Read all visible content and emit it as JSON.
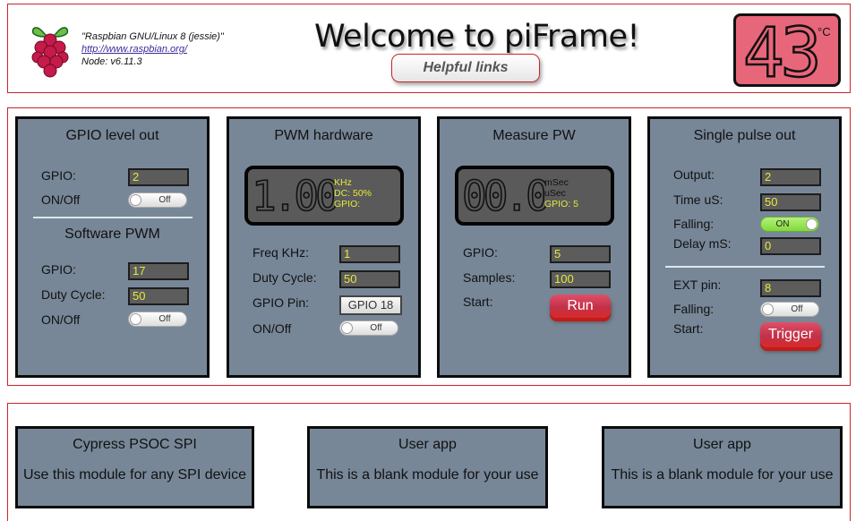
{
  "header": {
    "sysinfo": {
      "os": "\"Raspbian GNU/Linux 8 (jessie)\"",
      "url": "http://www.raspbian.org/",
      "node": "Node: v6.11.3"
    },
    "title": "Welcome to piFrame!",
    "helpful_links_label": "Helpful links",
    "temperature": {
      "value": "43",
      "unit": "°C",
      "color": "#e8667a"
    }
  },
  "modules": {
    "gpio_level_out": {
      "title": "GPIO level out",
      "gpio_label": "GPIO:",
      "gpio_value": "2",
      "onoff_label": "ON/Off",
      "toggle_label": "Off",
      "software_pwm": {
        "title": "Software PWM",
        "gpio_label": "GPIO:",
        "gpio_value": "17",
        "duty_label": "Duty Cycle:",
        "duty_value": "50",
        "onoff_label": "ON/Off",
        "toggle_label": "Off"
      }
    },
    "pwm_hardware": {
      "title": "PWM hardware",
      "display": {
        "value": "1.00",
        "unit": "KHz",
        "dc": "DC: 50%",
        "gpio": "GPIO:"
      },
      "freq_label": "Freq KHz:",
      "freq_value": "1",
      "duty_label": "Duty Cycle:",
      "duty_value": "50",
      "gpio_pin_label": "GPIO Pin:",
      "gpio_pin_button": "GPIO 18",
      "onoff_label": "ON/Off",
      "toggle_label": "Off"
    },
    "measure_pw": {
      "title": "Measure PW",
      "display": {
        "value": "00.0",
        "unit1": "mSec",
        "unit2": "uSec",
        "gpio": "GPIO: 5"
      },
      "gpio_label": "GPIO:",
      "gpio_value": "5",
      "samples_label": "Samples:",
      "samples_value": "100",
      "start_label": "Start:",
      "run_label": "Run"
    },
    "single_pulse_out": {
      "title": "Single pulse out",
      "output_label": "Output:",
      "output_value": "2",
      "time_label": "Time uS:",
      "time_value": "50",
      "falling_label": "Falling:",
      "falling_toggle": "ON",
      "delay_label": "Delay mS:",
      "delay_value": "0",
      "ext_label": "EXT pin:",
      "ext_value": "8",
      "falling2_label": "Falling:",
      "falling2_toggle": "Off",
      "start_label": "Start:",
      "trigger_label": "Trigger"
    }
  },
  "bottom": [
    {
      "title": "Cypress PSOC SPI",
      "desc": "Use this module for any SPI device"
    },
    {
      "title": "User app",
      "desc": "This is a blank module for your use"
    },
    {
      "title": "User app",
      "desc": "This is a blank module for your use"
    }
  ],
  "colors": {
    "accent_red": "#c9252b",
    "panel": "#778798",
    "lcd_text": "#e6e93a"
  }
}
